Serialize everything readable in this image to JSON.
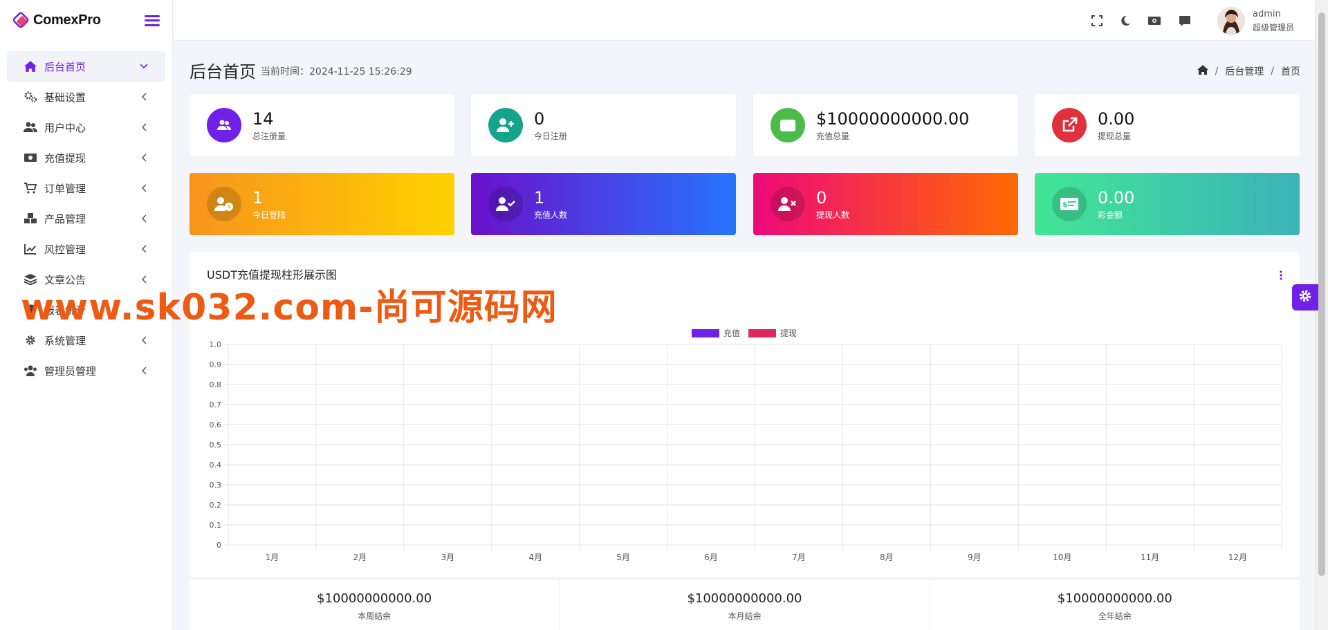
{
  "brand": {
    "name": "ComexPro"
  },
  "sidebar": {
    "items": [
      {
        "label": "后台首页",
        "icon": "home-icon",
        "active": true
      },
      {
        "label": "基础设置",
        "icon": "cogs-icon"
      },
      {
        "label": "用户中心",
        "icon": "users-icon"
      },
      {
        "label": "充值提现",
        "icon": "money-icon"
      },
      {
        "label": "订单管理",
        "icon": "cart-icon"
      },
      {
        "label": "产品管理",
        "icon": "cubes-icon"
      },
      {
        "label": "风控管理",
        "icon": "line-chart-icon"
      },
      {
        "label": "文章公告",
        "icon": "layers-icon"
      },
      {
        "label": "报表统计",
        "icon": "coins-icon"
      },
      {
        "label": "系统管理",
        "icon": "gear-icon"
      },
      {
        "label": "管理员管理",
        "icon": "user-group-icon"
      }
    ]
  },
  "topbar": {
    "icons": [
      "fullscreen-icon",
      "moon-icon",
      "money-bill-icon",
      "message-icon"
    ],
    "user": {
      "name": "admin",
      "role": "超级管理员"
    }
  },
  "page": {
    "title": "后台首页",
    "time_label": "当前时间：2024-11-25 15:26:29",
    "breadcrumb": [
      "后台管理",
      "首页"
    ]
  },
  "stats_row1": [
    {
      "value": "14",
      "label": "总注册量",
      "color": "#6f21e8",
      "icon": "users-icon"
    },
    {
      "value": "0",
      "label": "今日注册",
      "color": "#14a38b",
      "icon": "user-plus-icon"
    },
    {
      "value": "$10000000000.00",
      "label": "充值总量",
      "color": "#4cbb4a",
      "icon": "wallet-icon"
    },
    {
      "value": "0.00",
      "label": "提现总量",
      "color": "#e0313f",
      "icon": "external-link-icon"
    }
  ],
  "stats_row2": [
    {
      "value": "1",
      "label": "今日登陆",
      "gradient": [
        "#f7941d",
        "#ffd200"
      ],
      "icon": "user-clock-icon"
    },
    {
      "value": "1",
      "label": "充值人数",
      "gradient": [
        "#6a11cb",
        "#2575fc"
      ],
      "icon": "user-check-icon"
    },
    {
      "value": "0",
      "label": "提现人数",
      "gradient": [
        "#ee0979",
        "#ff6a00"
      ],
      "icon": "user-times-icon"
    },
    {
      "value": "0.00",
      "label": "彩金额",
      "gradient": [
        "#42e695",
        "#3bb2b8"
      ],
      "icon": "money-check-icon"
    }
  ],
  "chart_panel": {
    "title": "USDT充值提现柱形展示图"
  },
  "chart_data": {
    "type": "bar",
    "title": "",
    "categories": [
      "1月",
      "2月",
      "3月",
      "4月",
      "5月",
      "6月",
      "7月",
      "8月",
      "9月",
      "10月",
      "11月",
      "12月"
    ],
    "series": [
      {
        "name": "充值",
        "color": "#6f21e8",
        "values": [
          0,
          0,
          0,
          0,
          0,
          0,
          0,
          0,
          0,
          0,
          0,
          0
        ]
      },
      {
        "name": "提现",
        "color": "#e0265e",
        "values": [
          0,
          0,
          0,
          0,
          0,
          0,
          0,
          0,
          0,
          0,
          0,
          0
        ]
      }
    ],
    "ylim": [
      0,
      1.0
    ],
    "yticks": [
      "0",
      "0.1",
      "0.2",
      "0.3",
      "0.4",
      "0.5",
      "0.6",
      "0.7",
      "0.8",
      "0.9",
      "1.0"
    ],
    "legend": "top-center",
    "grid": true
  },
  "summary": [
    {
      "value": "$10000000000.00",
      "label": "本周结余"
    },
    {
      "value": "$10000000000.00",
      "label": "本月结余"
    },
    {
      "value": "$10000000000.00",
      "label": "全年结余"
    }
  ],
  "watermark": "www.sk032.com-尚可源码网"
}
